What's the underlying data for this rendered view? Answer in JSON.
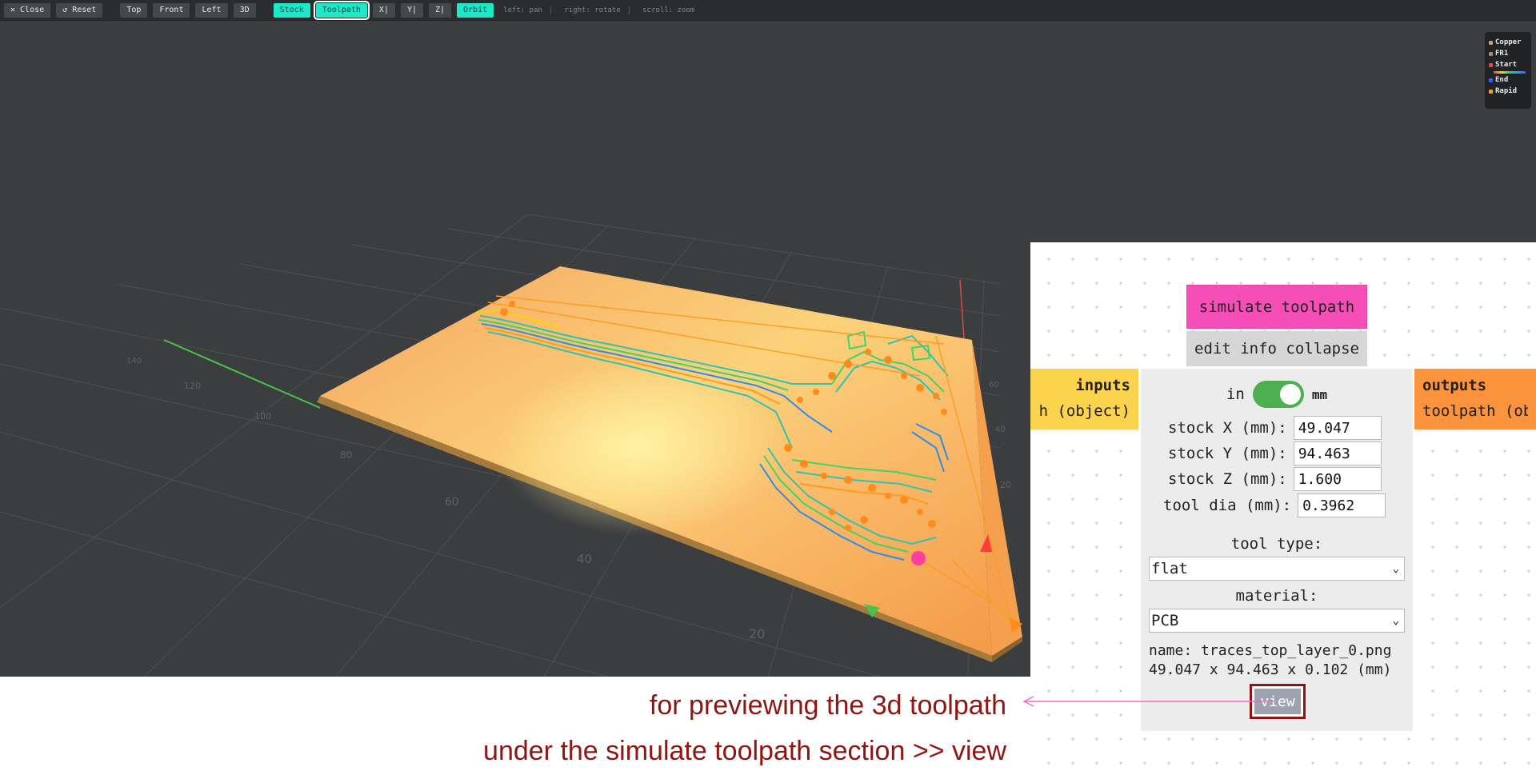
{
  "toolbar": {
    "close": "✕ Close",
    "reset": "↺ Reset",
    "views": [
      "Top",
      "Front",
      "Left",
      "3D"
    ],
    "stock": "Stock",
    "toolpath": "Toolpath",
    "axes": [
      "X|",
      "Y|",
      "Z|"
    ],
    "orbit": "Orbit",
    "hints": [
      "left: pan",
      "right: rotate",
      "scroll: zoom"
    ]
  },
  "legend": {
    "copper": "Copper",
    "fr1": "FR1",
    "start": "Start",
    "end": "End",
    "rapid": "Rapid",
    "colors": {
      "copper": "#c8a06a",
      "fr1": "#a88d66",
      "start": "#ff3b3b",
      "end": "#3060ff",
      "rapid": "#ff9a1f"
    }
  },
  "axis_labels": [
    "140",
    "120",
    "100",
    "80",
    "60",
    "40",
    "20",
    "60",
    "40",
    "20"
  ],
  "node": {
    "simulate_label": "simulate toolpath",
    "collapse_label": "edit info collapse",
    "inputs_title": "inputs",
    "inputs_item": "toolpath (object)",
    "outputs_title": "outputs",
    "outputs_item": "toolpath (object)",
    "unit_in": "in",
    "unit_mm": "mm",
    "stock_x_label": "stock X (mm):",
    "stock_x": "49.047",
    "stock_y_label": "stock Y (mm):",
    "stock_y": "94.463",
    "stock_z_label": "stock Z (mm):",
    "stock_z": "1.600",
    "tool_dia_label": "tool dia (mm):",
    "tool_dia": "0.3962",
    "tool_type_label": "tool type:",
    "tool_type": "flat",
    "material_label": "material:",
    "material": "PCB",
    "name_line": "name: traces_top_layer_0.png",
    "dims_line": "49.047 x 94.463 x 0.102 (mm)",
    "view_label": "view"
  },
  "annotation": {
    "line1": "for previewing the 3d toolpath",
    "line2": "under the simulate toolpath section >> view",
    "color": "#8e1612"
  }
}
